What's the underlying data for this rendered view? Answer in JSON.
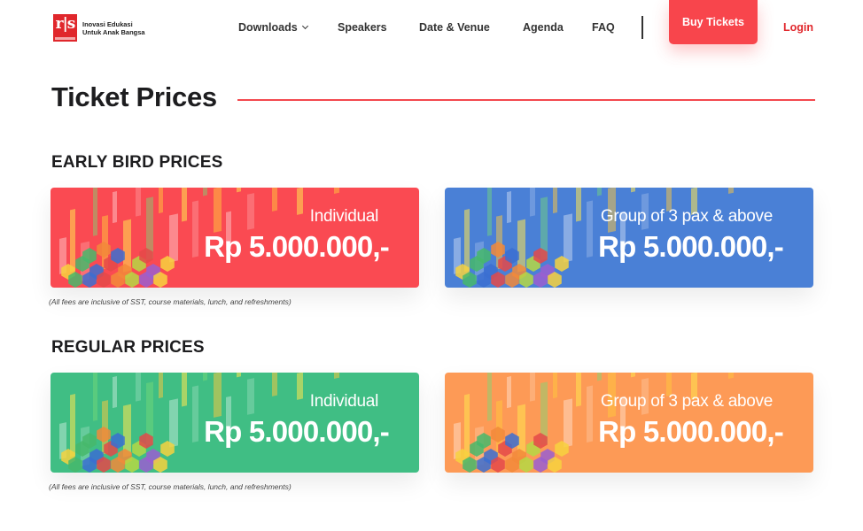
{
  "brand": {
    "logo_mark": "r|s",
    "tagline_1": "Inovasi Edukasi",
    "tagline_2": "Untuk Anak Bangsa"
  },
  "nav": {
    "downloads": "Downloads",
    "speakers": "Speakers",
    "date_venue": "Date & Venue",
    "agenda": "Agenda",
    "faq": "FAQ",
    "buy_tickets": "Buy Tickets",
    "login": "Login"
  },
  "page": {
    "title": "Ticket Prices"
  },
  "early_bird": {
    "heading": "EARLY BIRD PRICES",
    "note": "(All fees are inclusive of SST, course materials, lunch, and refreshments)",
    "cards": [
      {
        "label": "Individual",
        "price": "Rp 5.000.000,-",
        "color": "#fa4a52"
      },
      {
        "label": "Group of 3 pax & above",
        "price": "Rp 5.000.000,-",
        "color": "#4a80d6"
      }
    ]
  },
  "regular": {
    "heading": "REGULAR PRICES",
    "note": "(All fees are inclusive of SST, course materials, lunch, and refreshments)",
    "cards": [
      {
        "label": "Individual",
        "price": "Rp 5.000.000,-",
        "color": "#40be84"
      },
      {
        "label": "Group of 3 pax & above",
        "price": "Rp 5.000.000,-",
        "color": "#fd9a56"
      }
    ]
  },
  "colors": {
    "accent": "#f8454c",
    "brand_red": "#e0272c"
  }
}
